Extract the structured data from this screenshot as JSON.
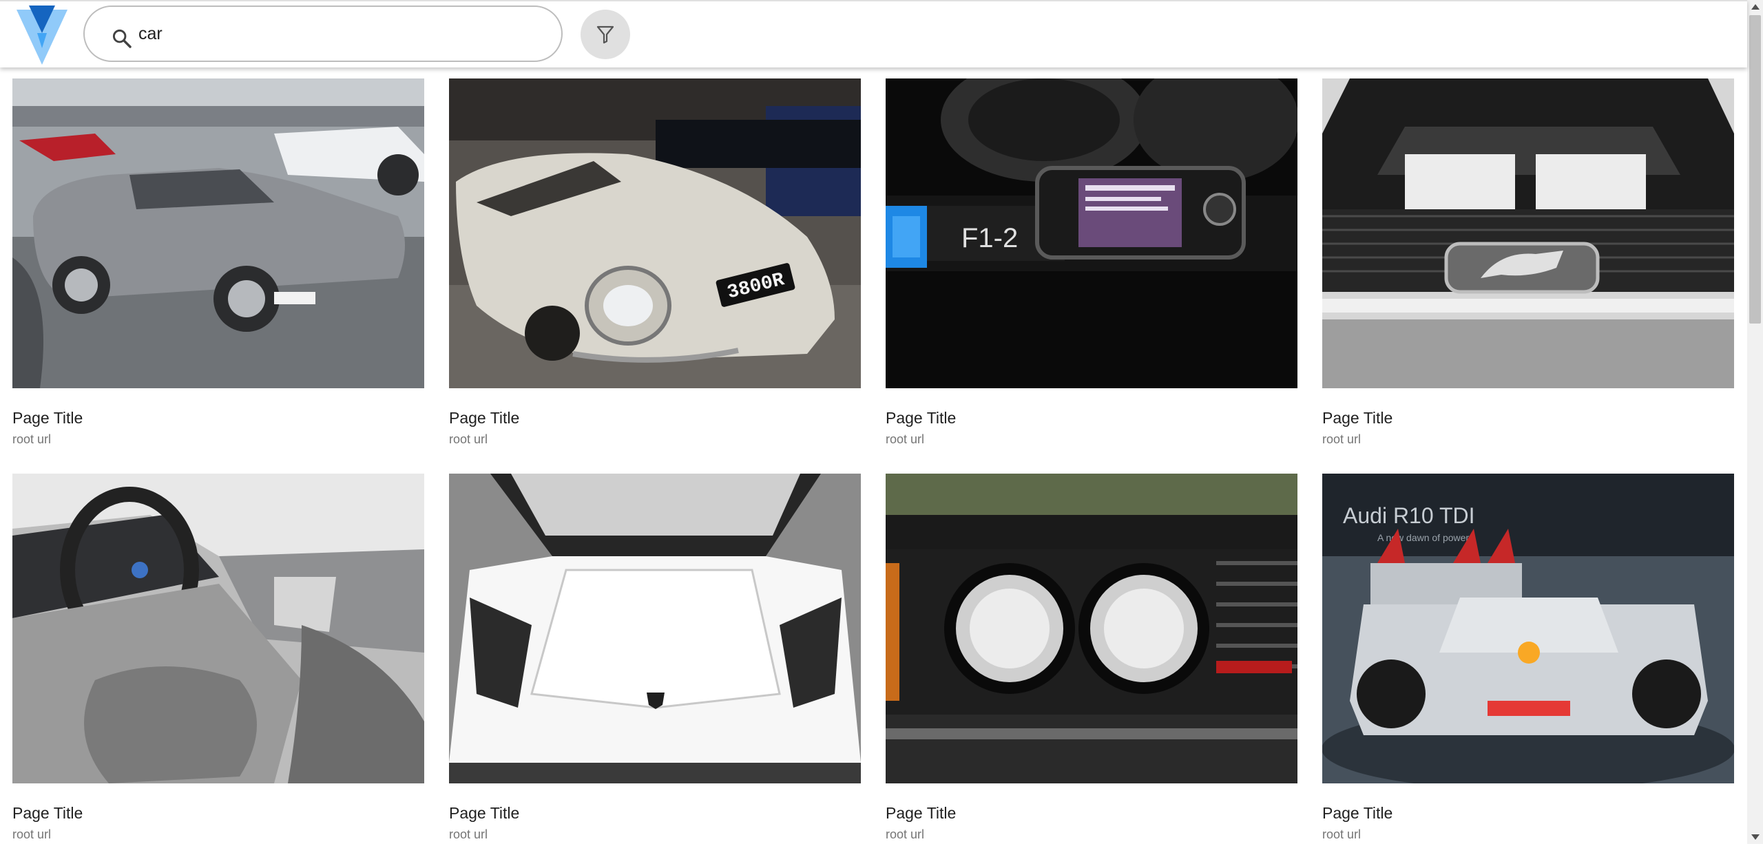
{
  "search": {
    "query": "car",
    "icon": "search-icon"
  },
  "filter": {
    "icon": "filter-icon"
  },
  "colors": {
    "logo_dark": "#1565c0",
    "logo_light": "#90caf9",
    "filter_bg": "#e0e0e0"
  },
  "results": [
    {
      "title": "Page Title",
      "url": "root url",
      "image": "silver-sports-coupe-photo"
    },
    {
      "title": "Page Title",
      "url": "root url",
      "image": "white-classic-roadster-photo",
      "plate": "3800R"
    },
    {
      "title": "Page Title",
      "url": "root url",
      "image": "phone-on-car-dashboard-photo",
      "display": "F1-2"
    },
    {
      "title": "Page Title",
      "url": "root url",
      "image": "mustang-grille-bw-photo"
    },
    {
      "title": "Page Title",
      "url": "root url",
      "image": "car-interior-photo"
    },
    {
      "title": "Page Title",
      "url": "root url",
      "image": "white-supercar-hood-photo"
    },
    {
      "title": "Page Title",
      "url": "root url",
      "image": "classic-car-headlights-photo"
    },
    {
      "title": "Page Title",
      "url": "root url",
      "image": "race-car-display-photo",
      "sign": "Audi R10 TDI",
      "sign_sub": "A new dawn of power"
    }
  ]
}
